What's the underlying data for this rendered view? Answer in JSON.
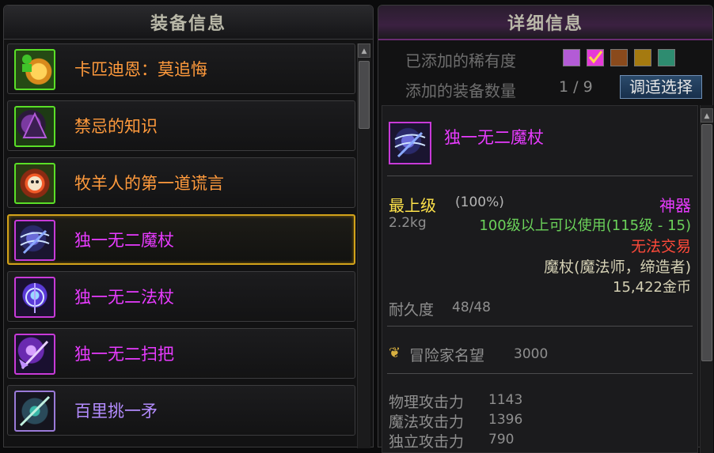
{
  "left_panel": {
    "title": "装备信息",
    "items": [
      {
        "name": "卡匹迪恩：莫追悔",
        "color": "#ff9a3c"
      },
      {
        "name": "禁忌的知识",
        "color": "#ff9a3c"
      },
      {
        "name": "牧羊人的第一道谎言",
        "color": "#ff9a3c"
      },
      {
        "name": "独一无二魔杖",
        "color": "#e83bff",
        "selected": true
      },
      {
        "name": "独一无二法杖",
        "color": "#e83bff"
      },
      {
        "name": "独一无二扫把",
        "color": "#e83bff"
      },
      {
        "name": "百里挑一矛",
        "color": "#b48cff"
      }
    ]
  },
  "right_panel": {
    "title": "详细信息",
    "rarity_label": "已添加的稀有度",
    "rarity_swatches": [
      "#b35bd6",
      "#e63ad8",
      "#8a4a1c",
      "#a57a10",
      "#2e8c70"
    ],
    "count_label": "添加的装备数量",
    "count_value": "1 / 9",
    "select_button": "调适选择",
    "detail": {
      "item_name": "独一无二魔杖",
      "grade": "最上级",
      "grade_pct": "(100%)",
      "rarity": "神器",
      "weight": "2.2kg",
      "level_req": "100级以上可以使用(115级 - 15)",
      "trade": "无法交易",
      "weapon_type": "魔杖(魔法师，缔造者)",
      "price": "15,422金币",
      "durability_label": "耐久度",
      "durability_value": "48/48",
      "fame_label": "冒险家名望",
      "fame_value": "3000",
      "stats": [
        {
          "label": "物理攻击力",
          "value": "1143"
        },
        {
          "label": "魔法攻击力",
          "value": "1396"
        },
        {
          "label": "独立攻击力",
          "value": "790"
        }
      ]
    }
  }
}
